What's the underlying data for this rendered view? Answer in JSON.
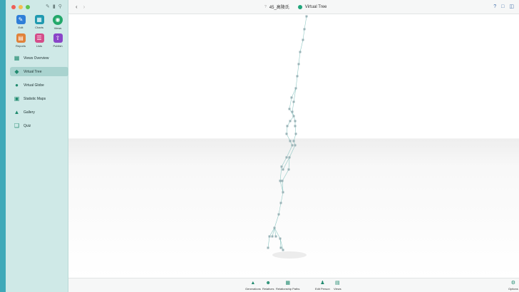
{
  "window": {
    "file_name": "45_高陵氏",
    "view_title": "Virtual Tree",
    "help_label": "?"
  },
  "apps": [
    {
      "label": "Edit",
      "icon": "pencil-icon",
      "color": "#2f7fd8"
    },
    {
      "label": "Charts",
      "icon": "charts-icon",
      "color": "#1f9ab0"
    },
    {
      "label": "Views",
      "icon": "eye-icon",
      "color": "#22a86a"
    },
    {
      "label": "Reports",
      "icon": "reports-icon",
      "color": "#e0823a"
    },
    {
      "label": "Lists",
      "icon": "lists-icon",
      "color": "#d44d8a"
    },
    {
      "label": "Publish",
      "icon": "publish-icon",
      "color": "#8a45c8"
    }
  ],
  "nav": [
    {
      "label": "Views Overview",
      "icon": "grid-icon"
    },
    {
      "label": "Virtual Tree",
      "icon": "cube-icon",
      "active": true
    },
    {
      "label": "Virtual Globe",
      "icon": "globe-icon"
    },
    {
      "label": "Statistic Maps",
      "icon": "map-icon"
    },
    {
      "label": "Gallery",
      "icon": "gallery-icon"
    },
    {
      "label": "Quiz",
      "icon": "quiz-icon"
    }
  ],
  "toolbar": [
    {
      "label": "Generations",
      "icon": "generations-icon"
    },
    {
      "label": "Relatives",
      "icon": "relatives-icon"
    },
    {
      "label": "Relationship Paths",
      "icon": "relationship-paths-icon"
    },
    {
      "label": "Edit Person",
      "icon": "edit-person-icon"
    },
    {
      "label": "Views",
      "icon": "views-icon"
    },
    {
      "label": "Options",
      "icon": "gear-icon"
    }
  ],
  "colors": {
    "accent": "#1f8a6e",
    "sidebar_bg": "#cfe9e7",
    "desktop": "#3fa9b8"
  }
}
